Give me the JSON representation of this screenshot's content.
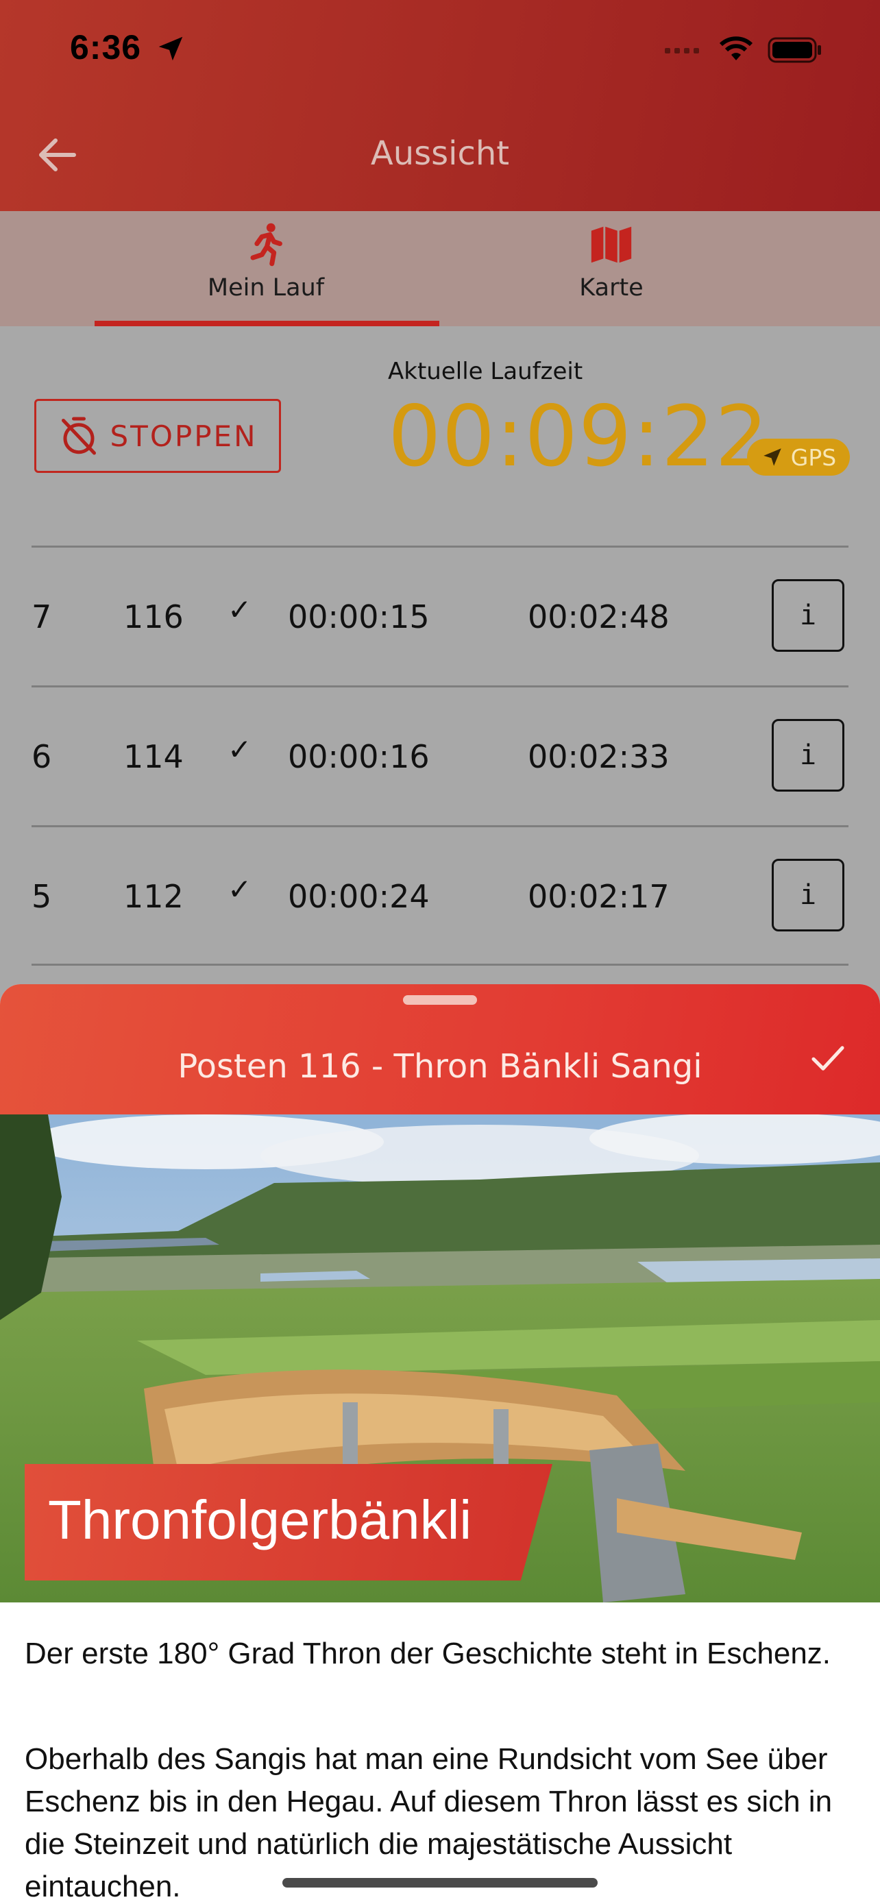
{
  "status_bar": {
    "time": "6:36"
  },
  "header": {
    "title": "Aussicht"
  },
  "tabs": [
    {
      "label": "Mein Lauf",
      "active": true
    },
    {
      "label": "Karte",
      "active": false
    }
  ],
  "run": {
    "stop_label": "STOPPEN",
    "timer_label": "Aktuelle Laufzeit",
    "timer_value": "00:09:22",
    "gps_label": "GPS"
  },
  "checkpoints": [
    {
      "index": "7",
      "post": "116",
      "check": "✓",
      "split": "00:00:15",
      "total": "00:02:48",
      "info": "i"
    },
    {
      "index": "6",
      "post": "114",
      "check": "✓",
      "split": "00:00:16",
      "total": "00:02:33",
      "info": "i"
    },
    {
      "index": "5",
      "post": "112",
      "check": "✓",
      "split": "00:00:24",
      "total": "00:02:17",
      "info": "i"
    }
  ],
  "sheet": {
    "title": "Posten 116 - Thron Bänkli Sangi",
    "photo_banner": "Thronfolgerbänkli",
    "paragraphs": [
      "Der erste 180° Grad Thron der Geschichte steht in Eschenz.",
      "Oberhalb des Sangis hat man eine Rundsicht vom See über Eschenz bis in den Hegau. Auf diesem Thron lässt es sich in die Steinzeit und natürlich die majestätische Aussicht eintauchen."
    ]
  },
  "colors": {
    "brand_red": "#c4241f",
    "timer_gold": "#d59a10",
    "sheet_header": "#e23c33"
  }
}
